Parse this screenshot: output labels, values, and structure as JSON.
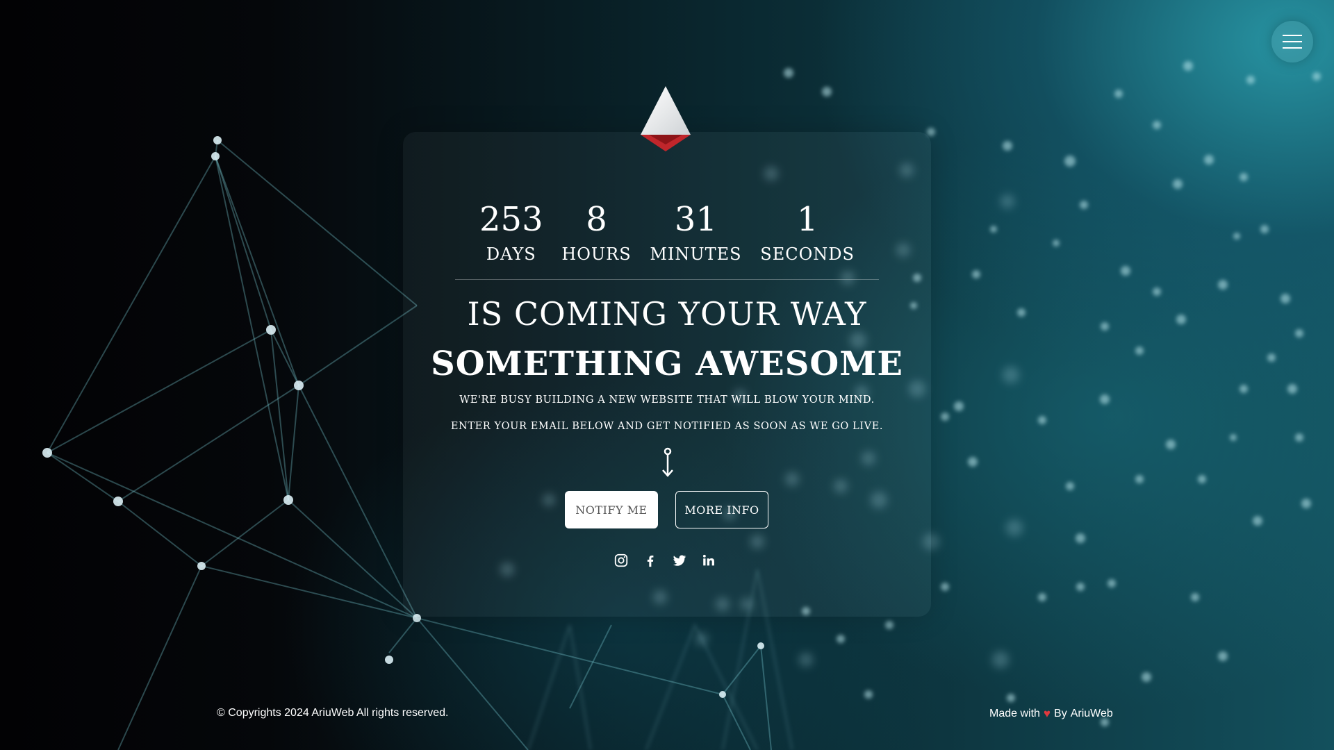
{
  "countdown": [
    {
      "value": "253",
      "label": "DAYS"
    },
    {
      "value": "8",
      "label": "HOURS"
    },
    {
      "value": "31",
      "label": "MINUTES"
    },
    {
      "value": "1",
      "label": "SECONDS"
    }
  ],
  "headline": {
    "sub": "IS COMING YOUR WAY",
    "main": "SOMETHING AWESOME"
  },
  "description": {
    "line1": "WE'RE BUSY BUILDING A NEW WEBSITE THAT WILL BLOW YOUR MIND.",
    "line2": "ENTER YOUR EMAIL BELOW AND GET NOTIFIED AS SOON AS WE GO LIVE."
  },
  "buttons": {
    "notify": "NOTIFY ME",
    "more_info": "MORE INFO"
  },
  "socials": [
    "instagram-icon",
    "facebook-icon",
    "twitter-icon",
    "linkedin-icon"
  ],
  "footer": {
    "copyright": "© Copyrights 2024 AriuWeb All rights reserved.",
    "made_with": "Made with",
    "heart": "♥",
    "by": "By",
    "author": "AriuWeb"
  },
  "colors": {
    "accent_red": "#c0262b",
    "heart": "#e0393e",
    "teal": "#13505d"
  }
}
